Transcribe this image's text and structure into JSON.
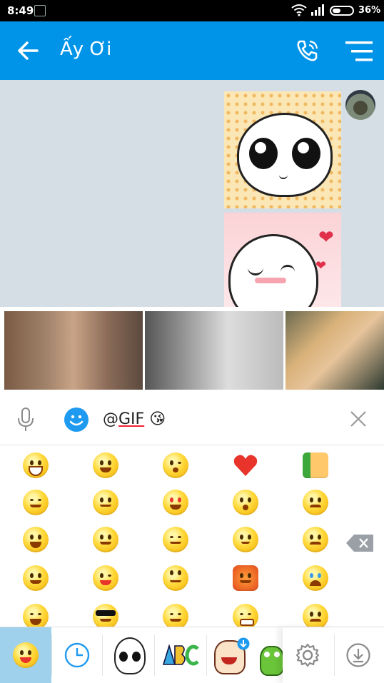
{
  "status_bar": {
    "time": "8:49",
    "battery": "36%"
  },
  "header": {
    "title": "Ấy Ơi"
  },
  "input": {
    "prefix": "@",
    "tag": "GIF",
    "placeholder_emoji": "😘"
  },
  "colors": {
    "header": "#0094e8",
    "chat_bg": "#d6dee5",
    "active_tab": "#9fd0ec"
  },
  "emoji_rows": [
    [
      "grin-icon",
      "tears-of-joy-icon",
      "kiss-wink-icon",
      "heart-icon",
      "thumbs-up-icon"
    ],
    [
      "squint-blush-icon",
      "teary-icon",
      "heart-eyes-icon",
      "surprised-icon",
      "worried-icon"
    ],
    [
      "big-smile-icon",
      "hand-mouth-icon",
      "smirk-icon",
      "confused-icon",
      "sad-sweat-icon"
    ],
    [
      "smile-icon",
      "tongue-wink-icon",
      "eye-roll-icon",
      "angry-icon",
      "crying-icon"
    ],
    [
      "laugh-icon",
      "sunglasses-icon",
      "blush-smile-icon",
      "grimace-icon",
      "frown-icon"
    ]
  ],
  "tabs": [
    "emoji-tab",
    "recent-tab",
    "sticker-bun-tab",
    "sticker-abc-tab",
    "sticker-character-tab",
    "sticker-frog-tab",
    "settings-tab",
    "download-tab"
  ]
}
